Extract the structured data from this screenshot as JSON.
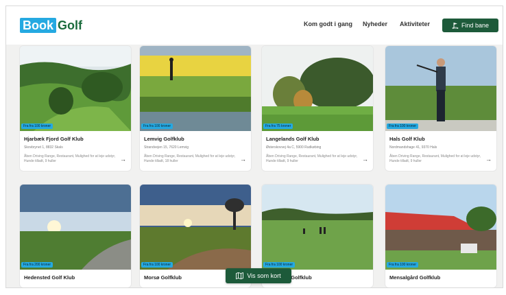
{
  "brand": {
    "book": "Book",
    "golf": "Golf"
  },
  "nav": [
    "Kom godt i gang",
    "Nyheder",
    "Aktiviteter"
  ],
  "find_button": "Find bane",
  "map_button": "Vis som kort",
  "cards": [
    {
      "badge": "Fra fra 100 kroner",
      "name": "Hjarbæk Fjord Golf Klub",
      "address": "Skovbrynet 1, 8832 Skals",
      "desc": "Åben Driving Range, Restaurant, Mulighed for at leje udstyr, Hunde tilladt, 9 huller"
    },
    {
      "badge": "Fra fra 100 kroner",
      "name": "Lemvig Golfklub",
      "address": "Strandvejen 15, 7620 Lemvig",
      "desc": "Åben Driving Range, Restaurant, Mulighed for at leje udstyr, Hunde tilladt, 18 huller"
    },
    {
      "badge": "Fra fra 75 kroner",
      "name": "Langelands Golf Klub",
      "address": "Østerskovvej 4a C, 5900 Rudkøbing",
      "desc": "Åben Driving Range, Restaurant, Mulighed for at leje udstyr, Hunde tilladt, 9 huller"
    },
    {
      "badge": "Fra fra 100 kroner",
      "name": "Hals Golf Klub",
      "address": "Nordmandshage 41, 9370 Hals",
      "desc": "Åben Driving Range, Restaurant, Mulighed for at leje udstyr, Hunde tilladt, 9 huller"
    },
    {
      "badge": "Fra fra 200 kroner",
      "name": "Hedensted Golf Klub",
      "address": "",
      "desc": ""
    },
    {
      "badge": "Fra fra 100 kroner",
      "name": "Morsø Golfklub",
      "address": "",
      "desc": ""
    },
    {
      "badge": "Fra fra 100 kroner",
      "name": "Nordborg Golfklub",
      "address": "",
      "desc": ""
    },
    {
      "badge": "Fra fra 100 kroner",
      "name": "Mensalgård Golfklub",
      "address": "",
      "desc": ""
    }
  ]
}
